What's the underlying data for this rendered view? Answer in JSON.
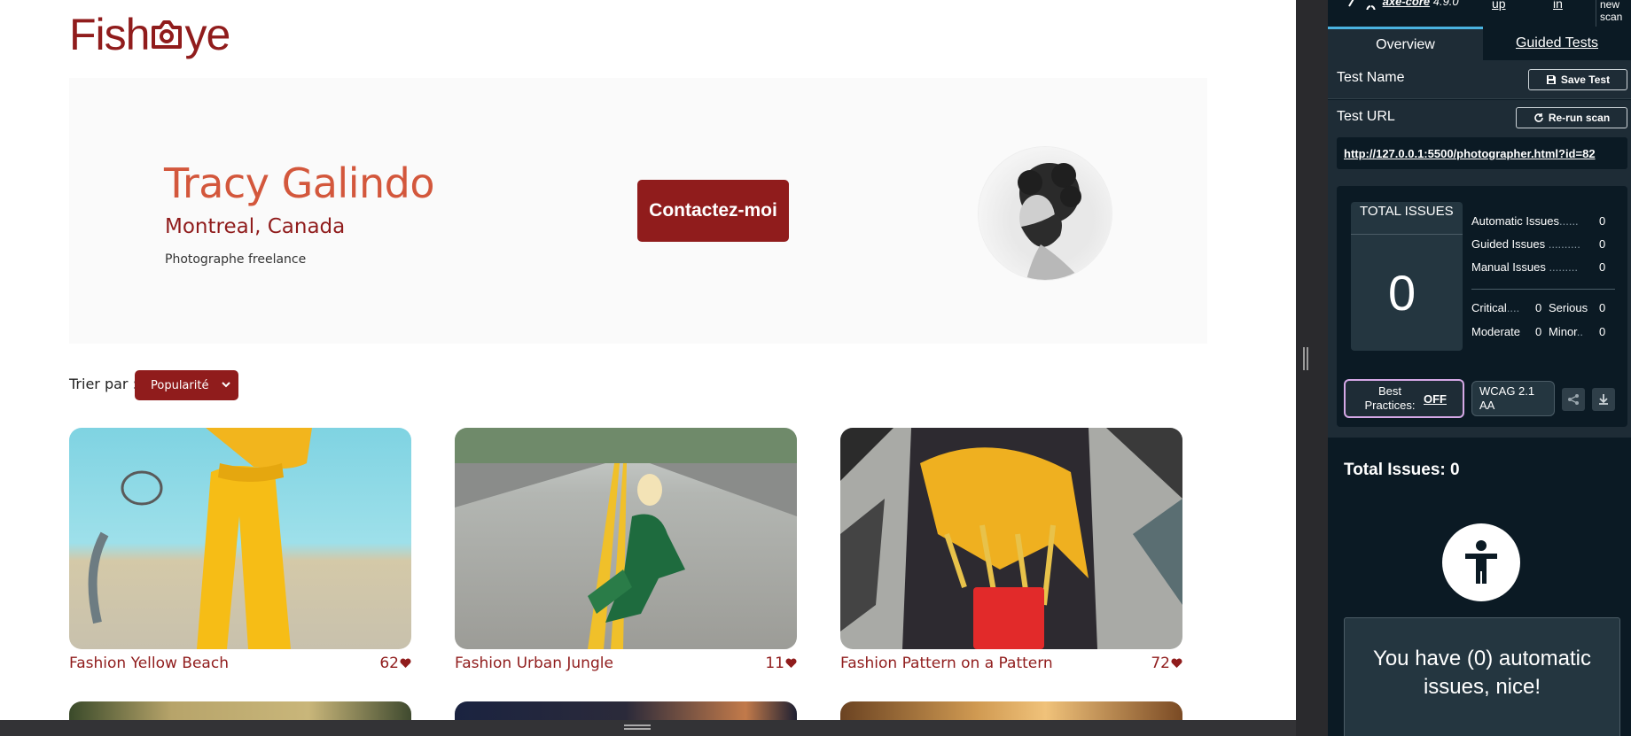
{
  "site": {
    "logo_left": "Fish",
    "logo_right": "ye"
  },
  "photographer": {
    "name": "Tracy Galindo",
    "location": "Montreal, Canada",
    "tagline": "Photographe freelance",
    "contact_label": "Contactez-moi"
  },
  "sort": {
    "label": "Trier par :",
    "selected": "Popularité"
  },
  "media": [
    {
      "title": "Fashion Yellow Beach",
      "likes": "62"
    },
    {
      "title": "Fashion Urban Jungle",
      "likes": "11"
    },
    {
      "title": "Fashion Pattern on a Pattern",
      "likes": "72"
    }
  ],
  "axe": {
    "nav": {
      "logo": "axe-core",
      "version": "4.9.0",
      "link1": "up",
      "link2": "in",
      "new_scan_line1": "new",
      "new_scan_line2": "scan"
    },
    "tabs": {
      "overview": "Overview",
      "guided": "Guided Tests"
    },
    "test_name_label": "Test Name",
    "save_test": "Save Test",
    "test_url_label": "Test URL",
    "rerun": "Re-run scan",
    "url": "http://127.0.0.1:5500/photographer.html?id=82",
    "summary": {
      "total_title": "TOTAL ISSUES",
      "total": "0",
      "automatic_label": "Automatic Issues",
      "automatic": "0",
      "guided_label": "Guided Issues",
      "guided": "0",
      "manual_label": "Manual Issues",
      "manual": "0",
      "critical_label": "Critical",
      "critical": "0",
      "serious_label": "Serious",
      "serious": "0",
      "moderate_label": "Moderate",
      "moderate": "0",
      "minor_label": "Minor",
      "minor": "0"
    },
    "best_practices_label": "Best Practices:",
    "best_practices_state": "OFF",
    "wcag": "WCAG 2.1 AA",
    "total_issues_label": "Total Issues:",
    "total_issues_value": "0",
    "nice_message": "You have (0) automatic issues, nice!"
  }
}
